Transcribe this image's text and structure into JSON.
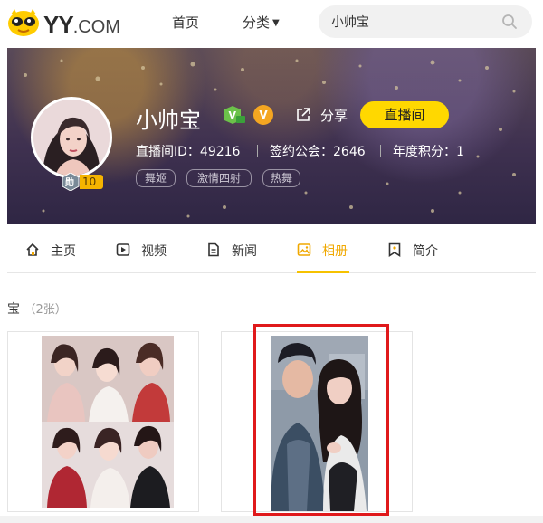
{
  "header": {
    "logo_text": "YY",
    "logo_domain": ".COM",
    "nav": [
      {
        "label": "首页"
      },
      {
        "label": "分类"
      }
    ],
    "search": {
      "value": "小帅宝",
      "placeholder": ""
    }
  },
  "profile": {
    "name": "小帅宝",
    "level": "10",
    "level_badge": "勋",
    "share_label": "分享",
    "live_button": "直播间",
    "stats": {
      "room_id": "直播间ID：49216",
      "guild": "签约公会：2646",
      "annual_points": "年度积分：1"
    },
    "tags": [
      "舞姬",
      "激情四射",
      "热舞"
    ]
  },
  "tabs": [
    {
      "label": "主页",
      "icon": "home-icon"
    },
    {
      "label": "视频",
      "icon": "video-icon"
    },
    {
      "label": "新闻",
      "icon": "news-icon"
    },
    {
      "label": "相册",
      "icon": "album-icon",
      "active": true
    },
    {
      "label": "简介",
      "icon": "intro-icon"
    }
  ],
  "album": {
    "title": "宝",
    "count": "（2张）"
  },
  "colors": {
    "accent": "#ffd800",
    "active_tab": "#f0a800",
    "highlight": "#e0191b"
  }
}
